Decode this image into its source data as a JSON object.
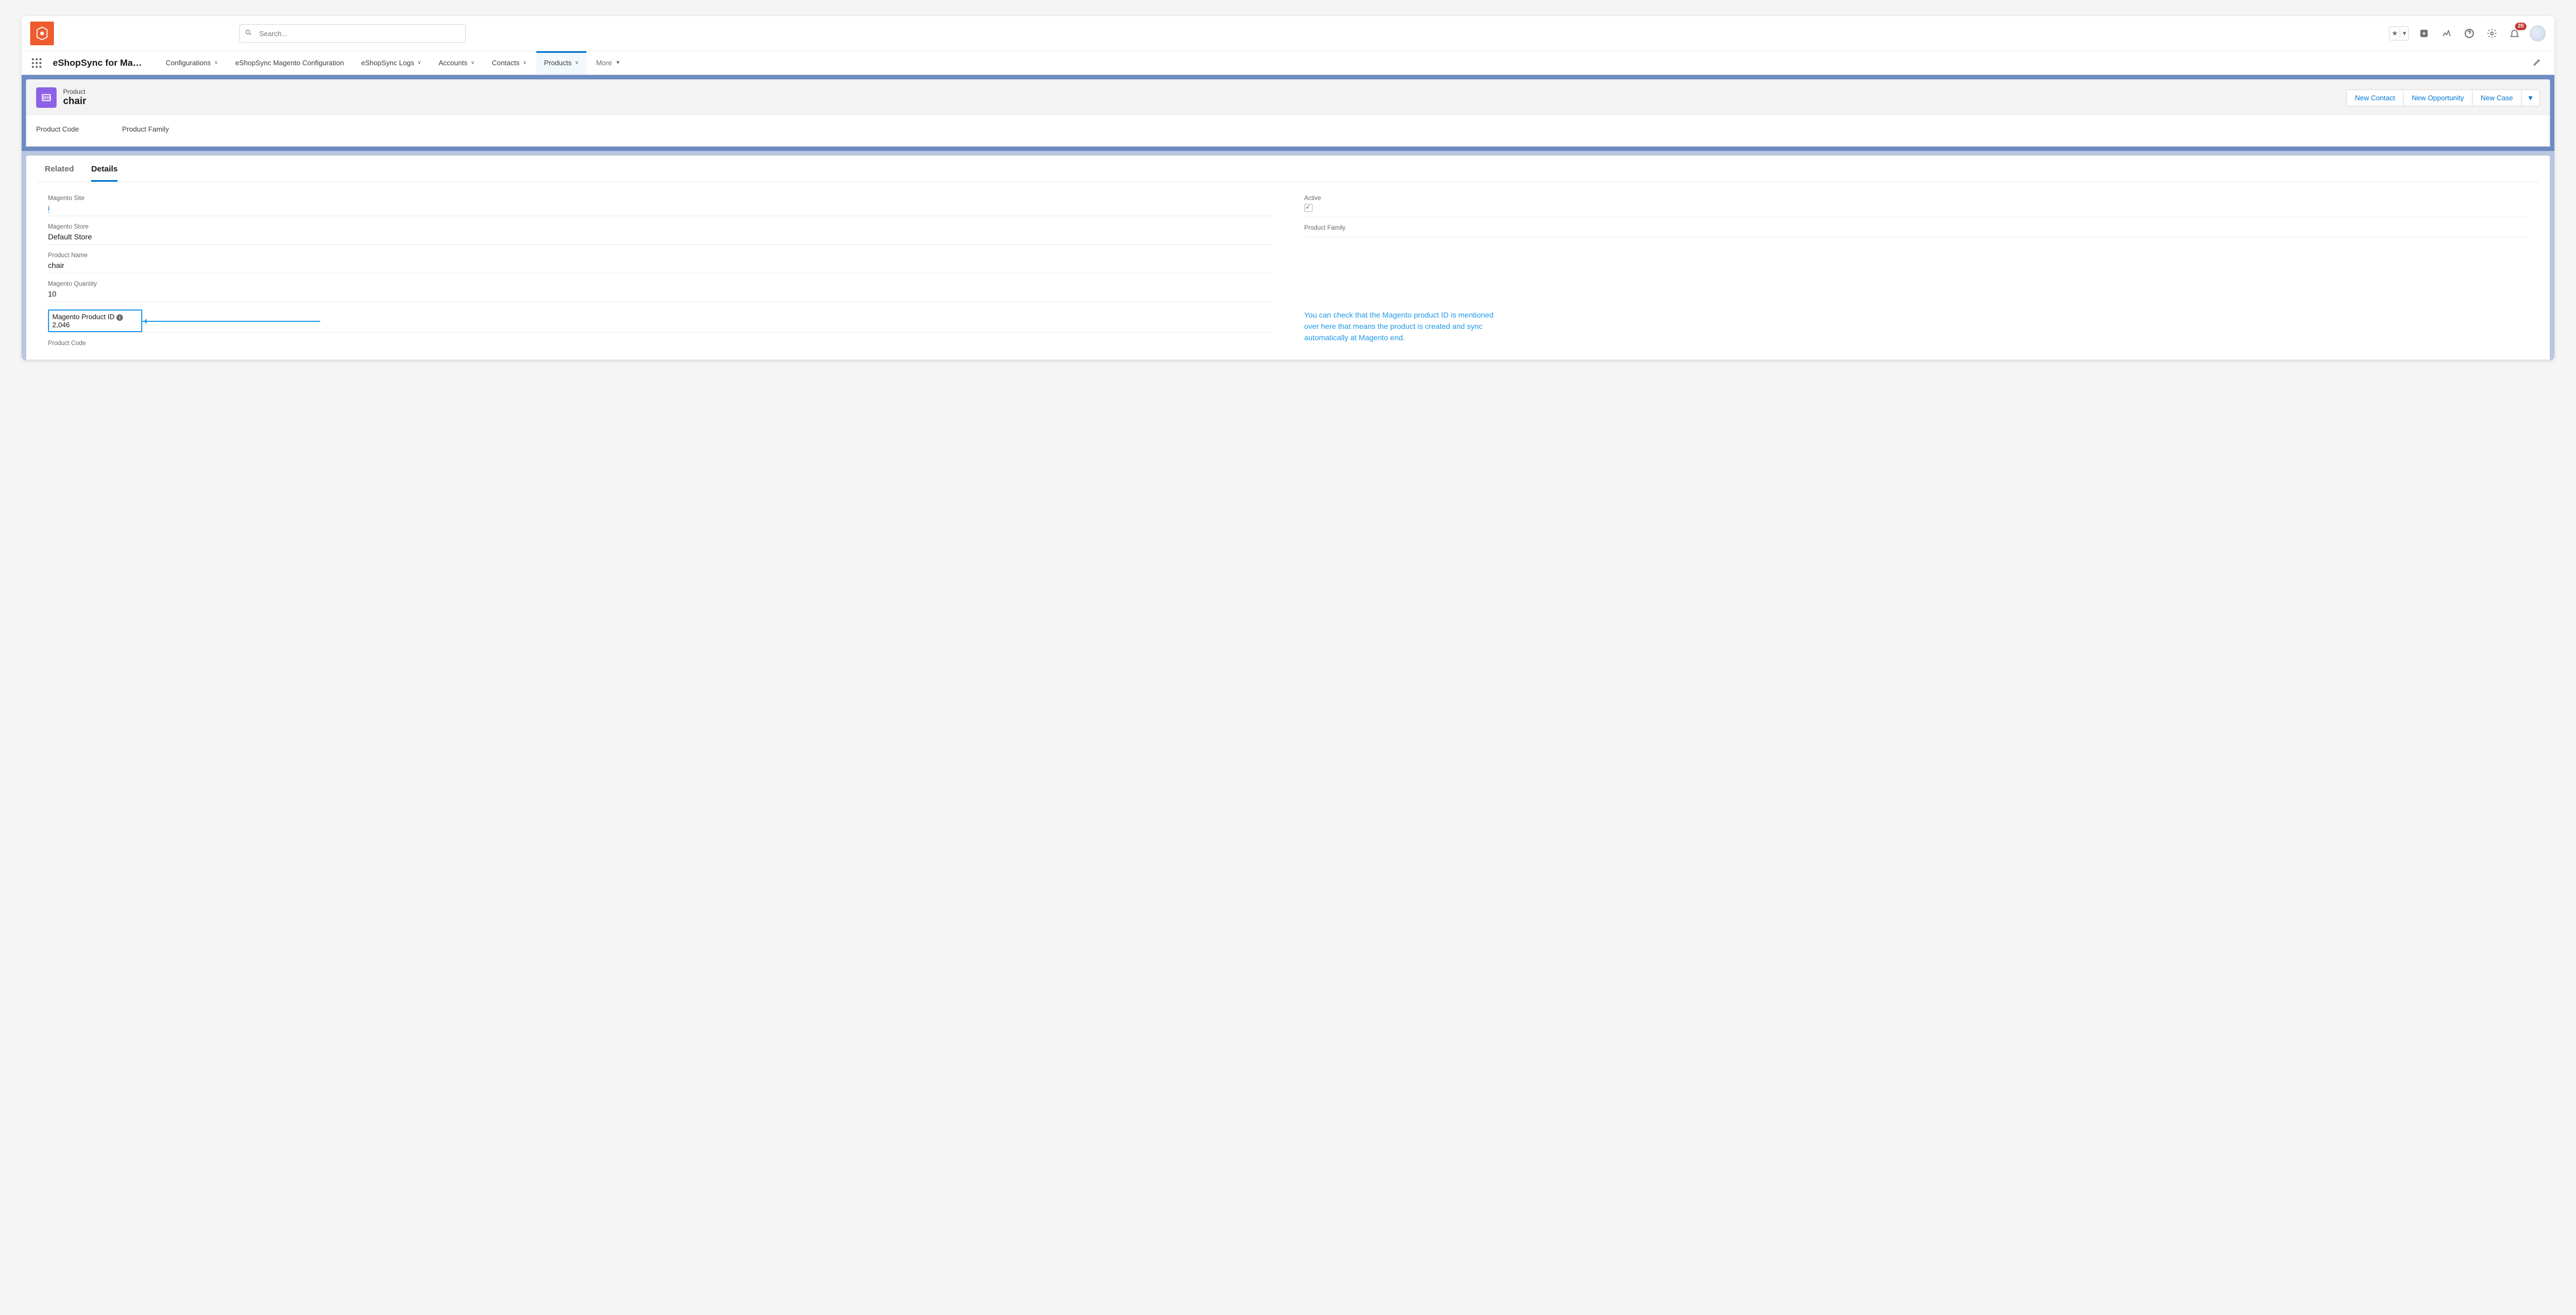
{
  "topbar": {
    "search_placeholder": "Search...",
    "notif_count": "20"
  },
  "navbar": {
    "app_title": "eShopSync for Ma…",
    "links": [
      {
        "label": "Configurations",
        "dropdown": true
      },
      {
        "label": "eShopSync Magento Configuration",
        "dropdown": false
      },
      {
        "label": "eShopSync Logs",
        "dropdown": true
      },
      {
        "label": "Accounts",
        "dropdown": true
      },
      {
        "label": "Contacts",
        "dropdown": true
      },
      {
        "label": "Products",
        "dropdown": true,
        "active": true
      },
      {
        "label": "More",
        "dropdown": true,
        "more": true
      }
    ]
  },
  "record_header": {
    "object_label": "Product",
    "record_name": "chair",
    "actions": {
      "new_contact": "New Contact",
      "new_opportunity": "New Opportunity",
      "new_case": "New Case"
    },
    "sub_fields": {
      "product_code": "Product Code",
      "product_family": "Product Family"
    }
  },
  "tabs": {
    "related": "Related",
    "details": "Details"
  },
  "details": {
    "left": {
      "magento_site": {
        "label": "Magento Site",
        "value": "i"
      },
      "magento_store": {
        "label": "Magento Store",
        "value": "Default Store"
      },
      "product_name": {
        "label": "Product Name",
        "value": "chair"
      },
      "magento_quantity": {
        "label": "Magento Quantity",
        "value": "10"
      },
      "magento_product_id": {
        "label": "Magento Product ID",
        "value": "2,046"
      },
      "product_code": {
        "label": "Product Code",
        "value": ""
      }
    },
    "right": {
      "active": {
        "label": "Active",
        "checked": true
      },
      "product_family": {
        "label": "Product Family",
        "value": ""
      }
    }
  },
  "annotation": "You can check that the Magento product ID is mentioned over here that means the product is created and sync automatically at Magento end."
}
